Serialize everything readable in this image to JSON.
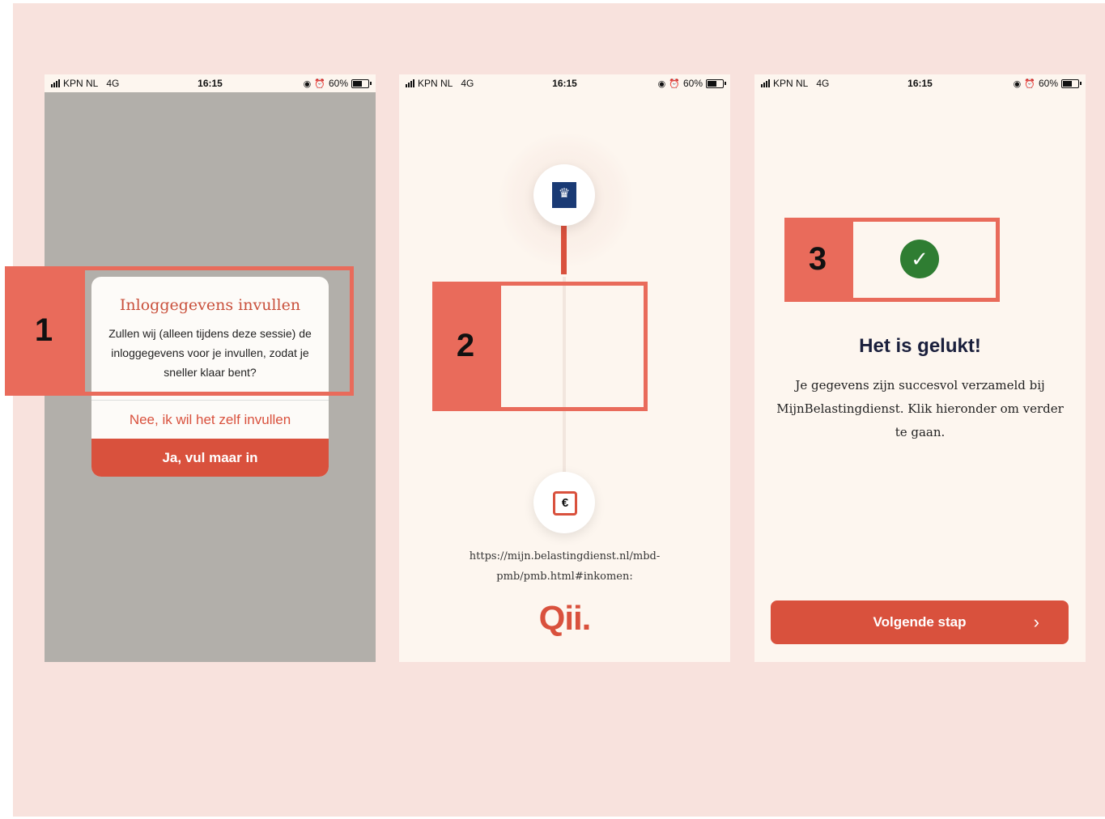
{
  "status_bar": {
    "carrier": "KPN NL",
    "network": "4G",
    "time": "16:15",
    "battery": "60%"
  },
  "screen1": {
    "dialog_title": "Inloggegevens invullen",
    "dialog_body": "Zullen wij (alleen tijdens deze sessie) de inloggegevens voor je invullen, zodat je sneller klaar bent?",
    "no_button": "Nee, ik wil het zelf invullen",
    "yes_button": "Ja, vul maar in"
  },
  "screen2": {
    "url_text": "https://mijn.belastingdienst.nl/mbd-pmb/pmb.html#inkomen:",
    "brand_logo_text": "Qii.",
    "euro_symbol": "€"
  },
  "screen3": {
    "heading": "Het is gelukt!",
    "body": "Je gegevens zijn succesvol verzameld bij MijnBelastingdienst. Klik hieronder om verder te gaan.",
    "next_button": "Volgende stap"
  },
  "callouts": [
    "1",
    "2",
    "3"
  ],
  "colors": {
    "accent": "#d9513d",
    "callout": "#e96b5b",
    "background": "#f8e2dd",
    "success": "#2f7d32"
  },
  "icons": [
    "signal-icon",
    "location-icon",
    "alarm-icon",
    "battery-icon",
    "government-logo-icon",
    "euro-icon",
    "check-circle-icon",
    "chevron-right-icon"
  ]
}
